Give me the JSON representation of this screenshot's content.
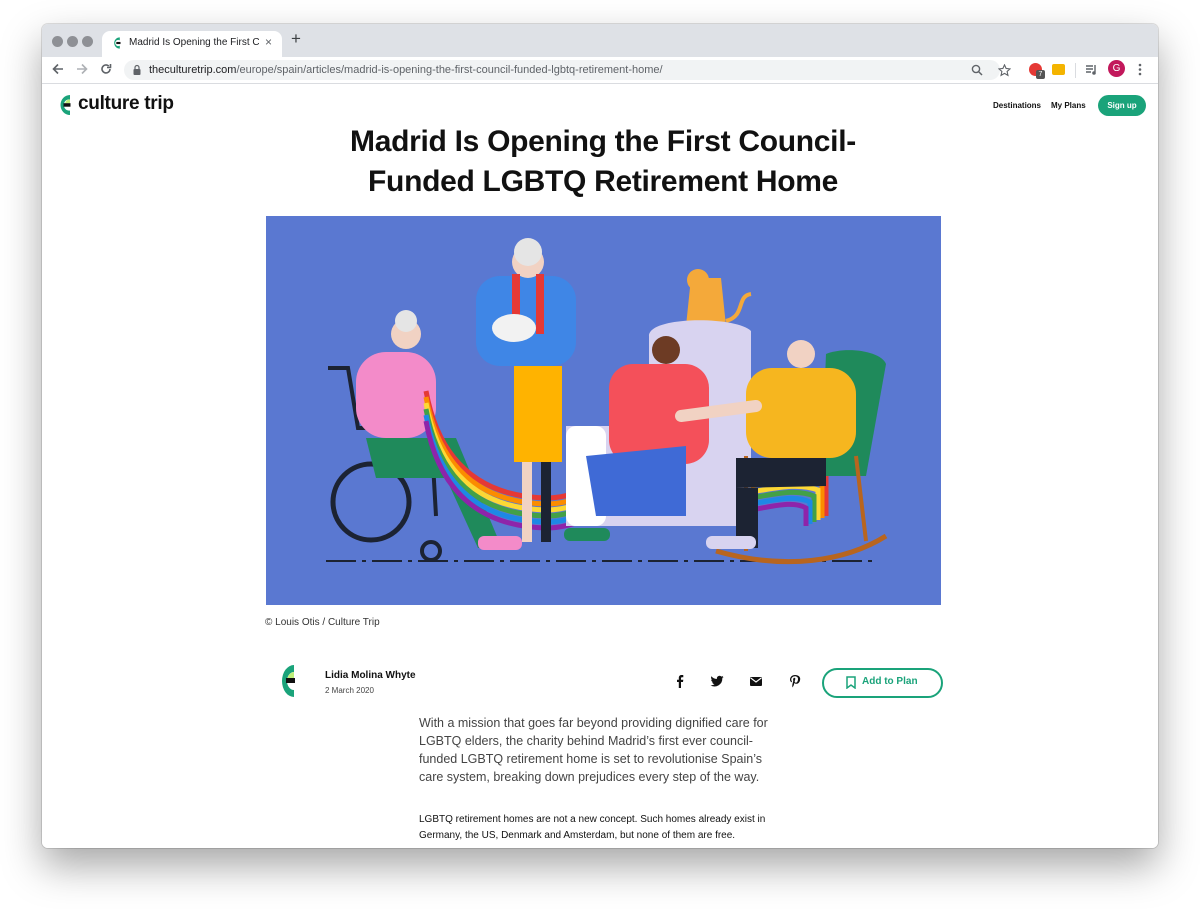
{
  "browser": {
    "tab_title": "Madrid Is Opening the First Co",
    "tab_close": "×",
    "new_tab": "+",
    "url_domain": "theculturetrip.com",
    "url_path": "/europe/spain/articles/madrid-is-opening-the-first-council-funded-lgbtq-retirement-home/",
    "extension_badge": "7",
    "profile_initial": "G",
    "nav_icons": [
      "back-icon",
      "forward-icon",
      "reload-icon"
    ],
    "omnibox_icons": [
      "lock-icon",
      "zoom-icon",
      "star-icon"
    ]
  },
  "site": {
    "logo_text": "culture trip",
    "nav": {
      "destinations": "Destinations",
      "my_plans": "My Plans",
      "sign_up": "Sign up"
    },
    "accent_color": "#1aa37a"
  },
  "article": {
    "headline_line1": "Madrid Is Opening the First Council-",
    "headline_line2": "Funded LGBTQ Retirement Home",
    "image_caption": "© Louis Otis / Culture Trip",
    "author_name": "Lidia Molina Whyte",
    "date": "2 March 2020",
    "share_icons": [
      "facebook-icon",
      "twitter-icon",
      "email-icon",
      "pinterest-icon"
    ],
    "add_to_plan": "Add to Plan",
    "lead_paragraph": "With a mission that goes far beyond providing dignified care for LGBTQ elders, the charity behind Madrid’s first ever council-funded LGBTQ retirement home is set to revolutionise Spain’s care system, breaking down prejudices every step of the way.",
    "body_paragraph": "LGBTQ retirement homes are not a new concept. Such homes already exist in Germany, the US, Denmark and Amsterdam, but none of them are free."
  }
}
